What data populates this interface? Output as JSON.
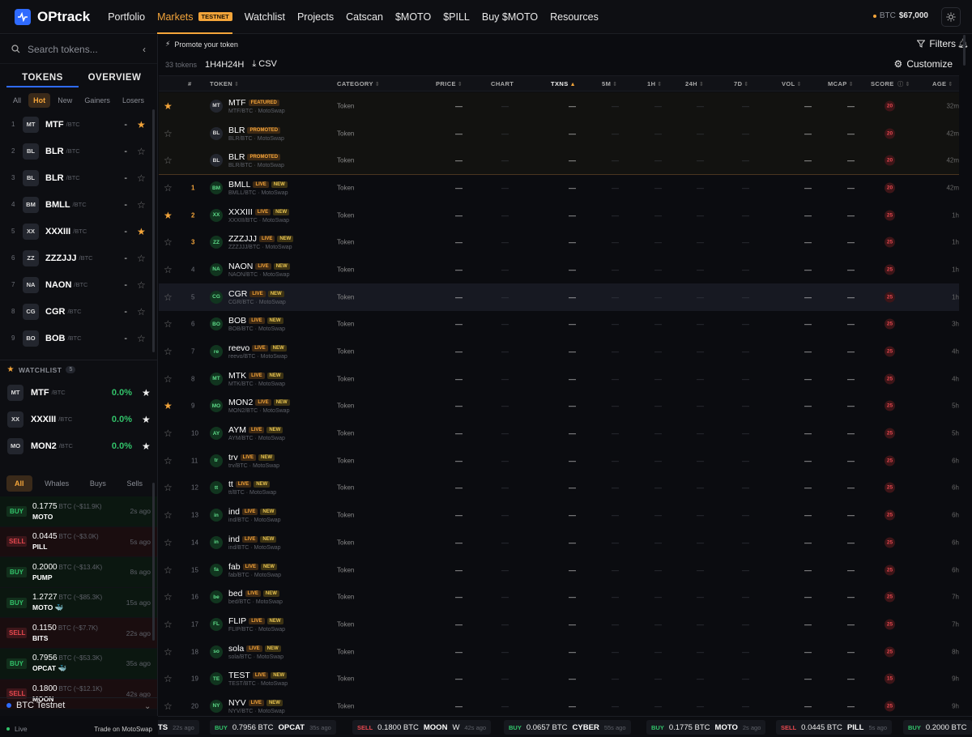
{
  "app": {
    "name": "OPtrack"
  },
  "nav": {
    "items": [
      {
        "label": "Portfolio"
      },
      {
        "label": "Markets",
        "badge": "TESTNET"
      },
      {
        "label": "Watchlist"
      },
      {
        "label": "Projects"
      },
      {
        "label": "Catscan"
      },
      {
        "label": "$MOTO"
      },
      {
        "label": "$PILL"
      },
      {
        "label": "Buy $MOTO"
      },
      {
        "label": "Resources"
      }
    ],
    "btc_label": "BTC",
    "btc_price": "$67,000"
  },
  "sidebar": {
    "search_placeholder": "Search tokens...",
    "tabs": [
      "TOKENS",
      "OVERVIEW"
    ],
    "filters": [
      "All",
      "Hot",
      "New",
      "Gainers",
      "Losers"
    ],
    "hot_tokens": [
      {
        "rank": "1",
        "avatar": "MT",
        "name": "MTF",
        "pair": "/BTC",
        "value": "-",
        "starred": true
      },
      {
        "rank": "2",
        "avatar": "BL",
        "name": "BLR",
        "pair": "/BTC",
        "value": "-",
        "starred": false
      },
      {
        "rank": "3",
        "avatar": "BL",
        "name": "BLR",
        "pair": "/BTC",
        "value": "-",
        "starred": false
      },
      {
        "rank": "4",
        "avatar": "BM",
        "name": "BMLL",
        "pair": "/BTC",
        "value": "-",
        "starred": false
      },
      {
        "rank": "5",
        "avatar": "XX",
        "name": "XXXIII",
        "pair": "/BTC",
        "value": "-",
        "starred": true
      },
      {
        "rank": "6",
        "avatar": "ZZ",
        "name": "ZZZJJJ",
        "pair": "/BTC",
        "value": "-",
        "starred": false
      },
      {
        "rank": "7",
        "avatar": "NA",
        "name": "NAON",
        "pair": "/BTC",
        "value": "-",
        "starred": false
      },
      {
        "rank": "8",
        "avatar": "CG",
        "name": "CGR",
        "pair": "/BTC",
        "value": "-",
        "starred": false
      },
      {
        "rank": "9",
        "avatar": "BO",
        "name": "BOB",
        "pair": "/BTC",
        "value": "-",
        "starred": false
      }
    ],
    "watchlist_label": "WATCHLIST",
    "watchlist_count": "5",
    "watchlist": [
      {
        "avatar": "MT",
        "name": "MTF",
        "pair": "/BTC",
        "change": "0.0%"
      },
      {
        "avatar": "XX",
        "name": "XXXIII",
        "pair": "/BTC",
        "change": "0.0%"
      },
      {
        "avatar": "MO",
        "name": "MON2",
        "pair": "/BTC",
        "change": "0.0%"
      }
    ],
    "trade_tabs": [
      "All",
      "Whales",
      "Buys",
      "Sells"
    ],
    "trades": [
      {
        "side": "BUY",
        "price": "0.1775",
        "sub": "BTC (~$11.9K)",
        "sym": "MOTO",
        "ago": "2s ago"
      },
      {
        "side": "SELL",
        "price": "0.0445",
        "sub": "BTC (~$3.0K)",
        "sym": "PILL",
        "ago": "5s ago"
      },
      {
        "side": "BUY",
        "price": "0.2000",
        "sub": "BTC (~$13.4K)",
        "sym": "PUMP",
        "ago": "8s ago"
      },
      {
        "side": "BUY",
        "price": "1.2727",
        "sub": "BTC (~$85.3K)",
        "sym": "MOTO 🐳",
        "ago": "15s ago"
      },
      {
        "side": "SELL",
        "price": "0.1150",
        "sub": "BTC (~$7.7K)",
        "sym": "BITS",
        "ago": "22s ago"
      },
      {
        "side": "BUY",
        "price": "0.7956",
        "sub": "BTC (~$53.3K)",
        "sym": "OPCAT 🐳",
        "ago": "35s ago"
      },
      {
        "side": "SELL",
        "price": "0.1800",
        "sub": "BTC (~$12.1K)",
        "sym": "MOON",
        "ago": "42s ago"
      }
    ],
    "network": "BTC Testnet",
    "live_label": "Live",
    "trade_on": "Trade on MotoSwap"
  },
  "main": {
    "promo": "Promote your token",
    "filters_label": "Filters",
    "token_count": "33 tokens",
    "timeframes": "1H4H24H",
    "csv": "CSV",
    "customize": "Customize",
    "columns": [
      "#",
      "TOKEN",
      "CATEGORY",
      "PRICE",
      "CHART",
      "TXNS",
      "5M",
      "1H",
      "24H",
      "7D",
      "VOL",
      "MCAP",
      "SCORE",
      "AGE"
    ],
    "rows": [
      {
        "rank": "",
        "avatar": "MT",
        "name": "MTF",
        "tags": [
          "FEATURED"
        ],
        "pair": "MTF/BTC · MotoSwap",
        "category": "Token",
        "score": "20",
        "age": "32m",
        "starred": true,
        "kind": "feat"
      },
      {
        "rank": "",
        "avatar": "BL",
        "name": "BLR",
        "tags": [
          "PROMOTED"
        ],
        "pair": "BLR/BTC · MotoSwap",
        "category": "Token",
        "score": "20",
        "age": "42m",
        "starred": false,
        "kind": "feat"
      },
      {
        "rank": "",
        "avatar": "BL",
        "name": "BLR",
        "tags": [
          "PROMOTED"
        ],
        "pair": "BLR/BTC · MotoSwap",
        "category": "Token",
        "score": "20",
        "age": "42m",
        "starred": false,
        "kind": "feat"
      },
      {
        "rank": "1",
        "avatar": "BM",
        "name": "BMLL",
        "tags": [
          "LIVE",
          "NEW"
        ],
        "pair": "BMLL/BTC · MotoSwap",
        "category": "Token",
        "score": "20",
        "age": "42m",
        "starred": false,
        "kind": "sep"
      },
      {
        "rank": "2",
        "avatar": "XX",
        "name": "XXXIII",
        "tags": [
          "LIVE",
          "NEW"
        ],
        "pair": "XXXIII/BTC · MotoSwap",
        "category": "Token",
        "score": "25",
        "age": "1h",
        "starred": true
      },
      {
        "rank": "3",
        "avatar": "ZZ",
        "name": "ZZZJJJ",
        "tags": [
          "LIVE",
          "NEW"
        ],
        "pair": "ZZZJJJ/BTC · MotoSwap",
        "category": "Token",
        "score": "25",
        "age": "1h",
        "starred": false
      },
      {
        "rank": "4",
        "avatar": "NA",
        "name": "NAON",
        "tags": [
          "LIVE",
          "NEW"
        ],
        "pair": "NAON/BTC · MotoSwap",
        "category": "Token",
        "score": "25",
        "age": "1h",
        "starred": false
      },
      {
        "rank": "5",
        "avatar": "CG",
        "name": "CGR",
        "tags": [
          "LIVE",
          "NEW"
        ],
        "pair": "CGR/BTC · MotoSwap",
        "category": "Token",
        "score": "25",
        "age": "1h",
        "starred": false,
        "kind": "hl"
      },
      {
        "rank": "6",
        "avatar": "BO",
        "name": "BOB",
        "tags": [
          "LIVE",
          "NEW"
        ],
        "pair": "BOB/BTC · MotoSwap",
        "category": "Token",
        "score": "25",
        "age": "3h",
        "starred": false
      },
      {
        "rank": "7",
        "avatar": "re",
        "name": "reevo",
        "tags": [
          "LIVE",
          "NEW"
        ],
        "pair": "reevo/BTC · MotoSwap",
        "category": "Token",
        "score": "25",
        "age": "4h",
        "starred": false
      },
      {
        "rank": "8",
        "avatar": "MT",
        "name": "MTK",
        "tags": [
          "LIVE",
          "NEW"
        ],
        "pair": "MTK/BTC · MotoSwap",
        "category": "Token",
        "score": "25",
        "age": "4h",
        "starred": false
      },
      {
        "rank": "9",
        "avatar": "MO",
        "name": "MON2",
        "tags": [
          "LIVE",
          "NEW"
        ],
        "pair": "MON2/BTC · MotoSwap",
        "category": "Token",
        "score": "25",
        "age": "5h",
        "starred": true
      },
      {
        "rank": "10",
        "avatar": "AY",
        "name": "AYM",
        "tags": [
          "LIVE",
          "NEW"
        ],
        "pair": "AYM/BTC · MotoSwap",
        "category": "Token",
        "score": "25",
        "age": "5h",
        "starred": false
      },
      {
        "rank": "11",
        "avatar": "tr",
        "name": "trv",
        "tags": [
          "LIVE",
          "NEW"
        ],
        "pair": "trv/BTC · MotoSwap",
        "category": "Token",
        "score": "25",
        "age": "6h",
        "starred": false
      },
      {
        "rank": "12",
        "avatar": "tt",
        "name": "tt",
        "tags": [
          "LIVE",
          "NEW"
        ],
        "pair": "tt/BTC · MotoSwap",
        "category": "Token",
        "score": "25",
        "age": "6h",
        "starred": false
      },
      {
        "rank": "13",
        "avatar": "in",
        "name": "ind",
        "tags": [
          "LIVE",
          "NEW"
        ],
        "pair": "ind/BTC · MotoSwap",
        "category": "Token",
        "score": "25",
        "age": "6h",
        "starred": false
      },
      {
        "rank": "14",
        "avatar": "in",
        "name": "ind",
        "tags": [
          "LIVE",
          "NEW"
        ],
        "pair": "ind/BTC · MotoSwap",
        "category": "Token",
        "score": "25",
        "age": "6h",
        "starred": false
      },
      {
        "rank": "15",
        "avatar": "fa",
        "name": "fab",
        "tags": [
          "LIVE",
          "NEW"
        ],
        "pair": "fab/BTC · MotoSwap",
        "category": "Token",
        "score": "25",
        "age": "6h",
        "starred": false
      },
      {
        "rank": "16",
        "avatar": "be",
        "name": "bed",
        "tags": [
          "LIVE",
          "NEW"
        ],
        "pair": "bed/BTC · MotoSwap",
        "category": "Token",
        "score": "25",
        "age": "7h",
        "starred": false
      },
      {
        "rank": "17",
        "avatar": "FL",
        "name": "FLIP",
        "tags": [
          "LIVE",
          "NEW"
        ],
        "pair": "FLIP/BTC · MotoSwap",
        "category": "Token",
        "score": "25",
        "age": "7h",
        "starred": false
      },
      {
        "rank": "18",
        "avatar": "so",
        "name": "sola",
        "tags": [
          "LIVE",
          "NEW"
        ],
        "pair": "sola/BTC · MotoSwap",
        "category": "Token",
        "score": "25",
        "age": "8h",
        "starred": false
      },
      {
        "rank": "19",
        "avatar": "TE",
        "name": "TEST",
        "tags": [
          "LIVE",
          "NEW"
        ],
        "pair": "TEST/BTC · MotoSwap",
        "category": "Token",
        "score": "15",
        "age": "9h",
        "starred": false
      },
      {
        "rank": "20",
        "avatar": "NY",
        "name": "NYV",
        "tags": [
          "LIVE",
          "NEW"
        ],
        "pair": "NYV/BTC · MotoSwap",
        "category": "Token",
        "score": "25",
        "age": "9h",
        "starred": false
      }
    ]
  },
  "ticker": [
    {
      "side": "",
      "amt": "",
      "sym": "TS",
      "ago": "22s ago"
    },
    {
      "side": "BUY",
      "amt": "0.7956 BTC",
      "sym": "OPCAT",
      "ago": "35s ago"
    },
    {
      "side": "SELL",
      "amt": "0.1800 BTC",
      "sym": "MOON",
      "extra": "W",
      "ago": "42s ago"
    },
    {
      "side": "BUY",
      "amt": "0.0657 BTC",
      "sym": "CYBER",
      "ago": "55s ago"
    },
    {
      "side": "BUY",
      "amt": "0.1775 BTC",
      "sym": "MOTO",
      "ago": "2s ago"
    },
    {
      "side": "SELL",
      "amt": "0.0445 BTC",
      "sym": "PILL",
      "ago": "5s ago"
    },
    {
      "side": "BUY",
      "amt": "0.2000 BTC",
      "sym": "",
      "ago": ""
    }
  ],
  "colors": {
    "accent": "#f4a53a",
    "brand": "#2f6bff",
    "up": "#32c36a",
    "down": "#e6484f"
  }
}
